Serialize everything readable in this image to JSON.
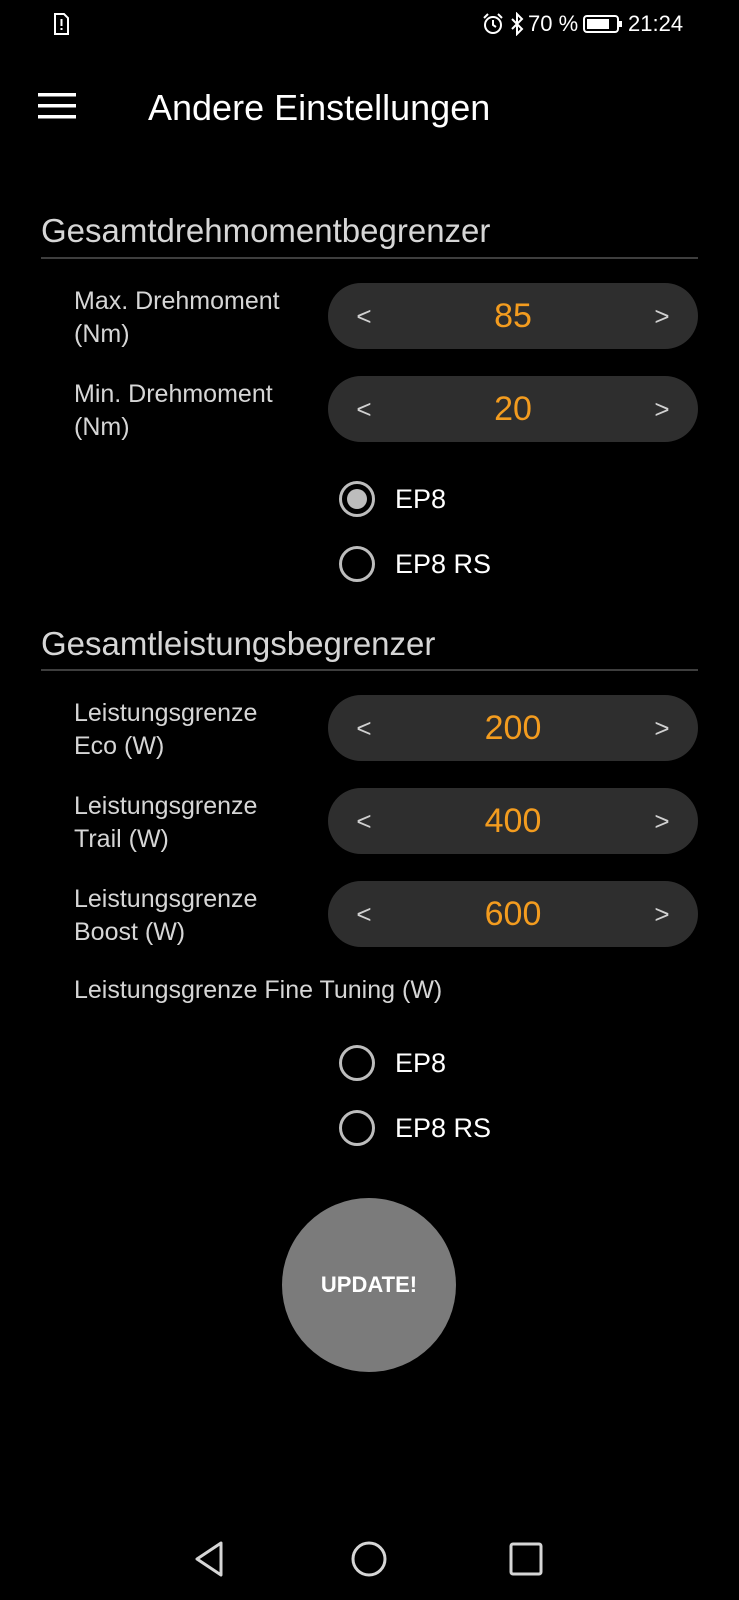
{
  "status_bar": {
    "battery_percent": "70 %",
    "time": "21:24",
    "icons": [
      "sim-alert-icon",
      "alarm-icon",
      "bluetooth-icon",
      "battery-icon"
    ]
  },
  "app_bar": {
    "title": "Andere Einstellungen",
    "menu_icon": "hamburger-menu-icon"
  },
  "torque_section": {
    "title": "Gesamtdrehmomentbegrenzer",
    "max_torque": {
      "label_line1": "Max. Drehmoment",
      "label_line2": "(Nm)",
      "value": "85"
    },
    "min_torque": {
      "label_line1": "Min. Drehmoment",
      "label_line2": "(Nm)",
      "value": "20"
    },
    "radio_options": [
      {
        "label": "EP8",
        "selected": true
      },
      {
        "label": "EP8 RS",
        "selected": false
      }
    ]
  },
  "power_section": {
    "title": "Gesamtleistungsbegrenzer",
    "eco": {
      "label_line1": "Leistungsgrenze",
      "label_line2": "Eco (W)",
      "value": "200"
    },
    "trail": {
      "label_line1": "Leistungsgrenze",
      "label_line2": "Trail (W)",
      "value": "400"
    },
    "boost": {
      "label_line1": "Leistungsgrenze",
      "label_line2": "Boost (W)",
      "value": "600"
    },
    "fine_tuning_label": "Leistungsgrenze Fine Tuning (W)",
    "radio_options": [
      {
        "label": "EP8",
        "selected": false
      },
      {
        "label": "EP8 RS",
        "selected": false
      }
    ]
  },
  "stepper_arrows": {
    "decrement": "<",
    "increment": ">"
  },
  "update_button": {
    "label": "UPDATE!"
  },
  "nav_bar": {
    "icons": [
      "back-icon",
      "home-icon",
      "recents-icon"
    ]
  },
  "colors": {
    "background": "#000000",
    "accent_value": "#f39c1f",
    "stepper_bg": "#2e2e2e",
    "button_bg": "#7b7b7b"
  }
}
